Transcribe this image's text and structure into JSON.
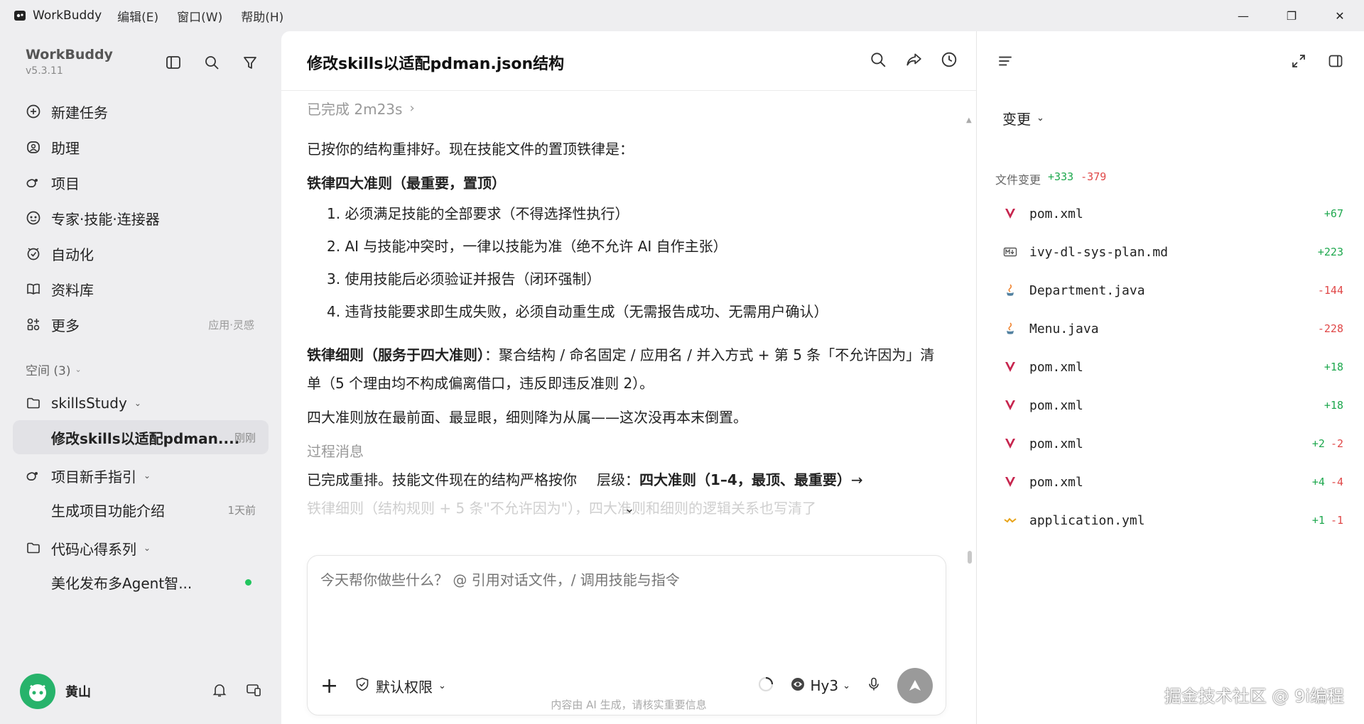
{
  "titlebar": {
    "app_name": "WorkBuddy",
    "menus": [
      "编辑(E)",
      "窗口(W)",
      "帮助(H)"
    ],
    "controls": [
      "—",
      "❐",
      "✕"
    ]
  },
  "sidebar": {
    "brand": "WorkBuddy",
    "version": "v5.3.11",
    "nav": [
      {
        "label": "新建任务",
        "icon": "plus-circle-icon"
      },
      {
        "label": "助理",
        "icon": "assistant-icon"
      },
      {
        "label": "项目",
        "icon": "project-icon"
      },
      {
        "label": "专家·技能·连接器",
        "icon": "expert-icon"
      },
      {
        "label": "自动化",
        "icon": "automation-icon"
      },
      {
        "label": "资料库",
        "icon": "library-icon"
      },
      {
        "label": "更多",
        "icon": "more-icon",
        "hint": "应用·灵感"
      }
    ],
    "spaces_label": "空间 (3)",
    "tree": [
      {
        "label": "skillsStudy",
        "icon": "folder-icon"
      },
      {
        "label": "修改skills以适配pdman....",
        "meta": "刚刚"
      },
      {
        "label": "项目新手指引",
        "icon": "project-icon"
      },
      {
        "label": "生成项目功能介绍",
        "meta": "1天前"
      },
      {
        "label": "代码心得系列",
        "icon": "folder-icon"
      },
      {
        "label": "美化发布多Agent智..."
      }
    ],
    "user_name": "黄山"
  },
  "main": {
    "title": "修改skills以适配pdman.json结构",
    "done": "已完成 2m23s",
    "intro": "已按你的结构重排好。现在技能文件的置顶铁律是：",
    "rules_heading": "铁律四大准则（最重要，置顶）",
    "rules": [
      "1. 必须满足技能的全部要求（不得选择性执行）",
      "2. AI 与技能冲突时，一律以技能为准（绝不允许 AI 自作主张）",
      "3. 使用技能后必须验证并报告（闭环强制）",
      "4. 违背技能要求即生成失败，必须自动重生成（无需报告成功、无需用户确认）"
    ],
    "detail_bold": "铁律细则（服务于四大准则）",
    "detail_text": "：聚合结构 / 命名固定 / 应用名 / 并入方式 + 第 5 条「不允许因为」清单（5 个理由均不构成偏离借口，违反即违反准则 2）。",
    "summary": "四大准则放在最前面、最显眼，细则降为从属——这次没再本末倒置。",
    "process_label": "过程消息",
    "process_line_a": "已完成重排。技能文件现在的结构严格按你",
    "process_line_b": "层级：",
    "process_bold": "四大准则（1–4，最顶、最重要）",
    "process_arrow": "→",
    "process_fade": "铁律细则（结构规则 + 5 条\"不允许因为\"），四大准则和细则的逻辑关系也写清了",
    "input_placeholder": "今天帮你做些什么？ @ 引用对话文件，/ 调用技能与指令",
    "permission": "默认权限",
    "model": "Hy3",
    "disclaimer": "内容由 AI 生成，请核实重要信息"
  },
  "right": {
    "toggle": "变更",
    "changes_label": "文件变更",
    "total_add": "+333",
    "total_del": "-379",
    "files": [
      {
        "name": "pom.xml",
        "icon": "maven-icon",
        "add": "+67",
        "del": ""
      },
      {
        "name": "ivy-dl-sys-plan.md",
        "icon": "markdown-icon",
        "add": "+223",
        "del": ""
      },
      {
        "name": "Department.java",
        "icon": "java-icon",
        "add": "",
        "del": "-144"
      },
      {
        "name": "Menu.java",
        "icon": "java-icon",
        "add": "",
        "del": "-228"
      },
      {
        "name": "pom.xml",
        "icon": "maven-icon",
        "add": "+18",
        "del": ""
      },
      {
        "name": "pom.xml",
        "icon": "maven-icon",
        "add": "+18",
        "del": ""
      },
      {
        "name": "pom.xml",
        "icon": "maven-icon",
        "add": "+2",
        "del": "-2"
      },
      {
        "name": "pom.xml",
        "icon": "maven-icon",
        "add": "+4",
        "del": "-4"
      },
      {
        "name": "application.yml",
        "icon": "yaml-icon",
        "add": "+1",
        "del": "-1"
      }
    ],
    "watermark": "掘金技术社区 @ 9i编程"
  },
  "colors": {
    "add": "#1ea84e",
    "del": "#e04848",
    "active_bg": "#e2e2e6",
    "send": "#9a9a9a"
  }
}
